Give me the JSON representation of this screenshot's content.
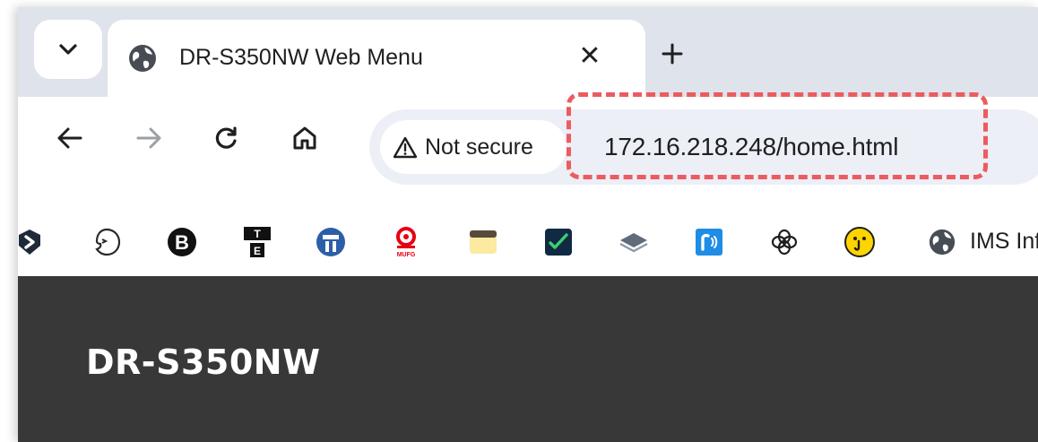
{
  "tab": {
    "title": "DR-S350NW Web Menu",
    "close_glyph": "✕",
    "favicon_icon": "globe-icon"
  },
  "toolbar": {
    "back_icon": "arrow-left-icon",
    "forward_icon": "arrow-right-icon",
    "reload_icon": "reload-icon",
    "home_icon": "home-icon"
  },
  "omnibox": {
    "security_label": "Not secure",
    "security_icon": "warning-triangle-icon",
    "url": "172.16.218.248/home.html",
    "highlight_color": "#ec5b5f"
  },
  "bookmarks": {
    "icons": [
      "shield-arrow-icon",
      "face-outline-icon",
      "b-circle-icon",
      "te-logo-icon",
      "blue-logo-icon",
      "mufg-icon",
      "notepad-icon",
      "chart-check-icon",
      "layers-icon",
      "r-logo-icon",
      "openai-icon",
      "yellow-face-icon"
    ],
    "last_label": "IMS Inf",
    "last_icon": "globe-icon",
    "mufg_text": "MUFG",
    "te_top": "T",
    "te_bottom": "E",
    "b_letter": "B"
  },
  "page": {
    "title": "DR-S350NW",
    "background": "#383838"
  }
}
